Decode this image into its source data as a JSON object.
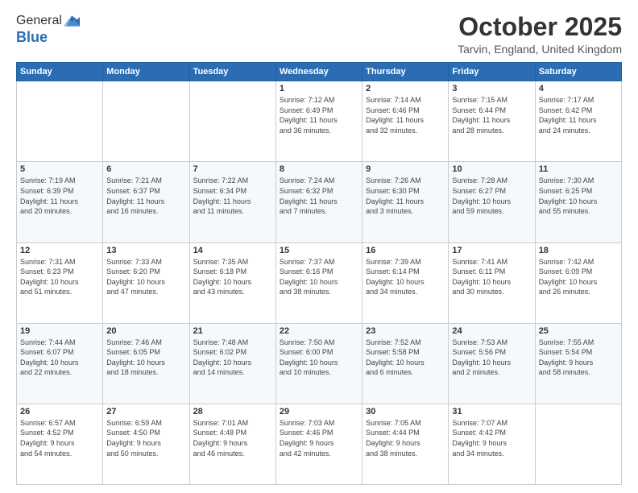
{
  "header": {
    "logo_line1": "General",
    "logo_line2": "Blue",
    "month": "October 2025",
    "location": "Tarvin, England, United Kingdom"
  },
  "weekdays": [
    "Sunday",
    "Monday",
    "Tuesday",
    "Wednesday",
    "Thursday",
    "Friday",
    "Saturday"
  ],
  "weeks": [
    [
      {
        "day": "",
        "info": ""
      },
      {
        "day": "",
        "info": ""
      },
      {
        "day": "",
        "info": ""
      },
      {
        "day": "1",
        "info": "Sunrise: 7:12 AM\nSunset: 6:49 PM\nDaylight: 11 hours\nand 36 minutes."
      },
      {
        "day": "2",
        "info": "Sunrise: 7:14 AM\nSunset: 6:46 PM\nDaylight: 11 hours\nand 32 minutes."
      },
      {
        "day": "3",
        "info": "Sunrise: 7:15 AM\nSunset: 6:44 PM\nDaylight: 11 hours\nand 28 minutes."
      },
      {
        "day": "4",
        "info": "Sunrise: 7:17 AM\nSunset: 6:42 PM\nDaylight: 11 hours\nand 24 minutes."
      }
    ],
    [
      {
        "day": "5",
        "info": "Sunrise: 7:19 AM\nSunset: 6:39 PM\nDaylight: 11 hours\nand 20 minutes."
      },
      {
        "day": "6",
        "info": "Sunrise: 7:21 AM\nSunset: 6:37 PM\nDaylight: 11 hours\nand 16 minutes."
      },
      {
        "day": "7",
        "info": "Sunrise: 7:22 AM\nSunset: 6:34 PM\nDaylight: 11 hours\nand 11 minutes."
      },
      {
        "day": "8",
        "info": "Sunrise: 7:24 AM\nSunset: 6:32 PM\nDaylight: 11 hours\nand 7 minutes."
      },
      {
        "day": "9",
        "info": "Sunrise: 7:26 AM\nSunset: 6:30 PM\nDaylight: 11 hours\nand 3 minutes."
      },
      {
        "day": "10",
        "info": "Sunrise: 7:28 AM\nSunset: 6:27 PM\nDaylight: 10 hours\nand 59 minutes."
      },
      {
        "day": "11",
        "info": "Sunrise: 7:30 AM\nSunset: 6:25 PM\nDaylight: 10 hours\nand 55 minutes."
      }
    ],
    [
      {
        "day": "12",
        "info": "Sunrise: 7:31 AM\nSunset: 6:23 PM\nDaylight: 10 hours\nand 51 minutes."
      },
      {
        "day": "13",
        "info": "Sunrise: 7:33 AM\nSunset: 6:20 PM\nDaylight: 10 hours\nand 47 minutes."
      },
      {
        "day": "14",
        "info": "Sunrise: 7:35 AM\nSunset: 6:18 PM\nDaylight: 10 hours\nand 43 minutes."
      },
      {
        "day": "15",
        "info": "Sunrise: 7:37 AM\nSunset: 6:16 PM\nDaylight: 10 hours\nand 38 minutes."
      },
      {
        "day": "16",
        "info": "Sunrise: 7:39 AM\nSunset: 6:14 PM\nDaylight: 10 hours\nand 34 minutes."
      },
      {
        "day": "17",
        "info": "Sunrise: 7:41 AM\nSunset: 6:11 PM\nDaylight: 10 hours\nand 30 minutes."
      },
      {
        "day": "18",
        "info": "Sunrise: 7:42 AM\nSunset: 6:09 PM\nDaylight: 10 hours\nand 26 minutes."
      }
    ],
    [
      {
        "day": "19",
        "info": "Sunrise: 7:44 AM\nSunset: 6:07 PM\nDaylight: 10 hours\nand 22 minutes."
      },
      {
        "day": "20",
        "info": "Sunrise: 7:46 AM\nSunset: 6:05 PM\nDaylight: 10 hours\nand 18 minutes."
      },
      {
        "day": "21",
        "info": "Sunrise: 7:48 AM\nSunset: 6:02 PM\nDaylight: 10 hours\nand 14 minutes."
      },
      {
        "day": "22",
        "info": "Sunrise: 7:50 AM\nSunset: 6:00 PM\nDaylight: 10 hours\nand 10 minutes."
      },
      {
        "day": "23",
        "info": "Sunrise: 7:52 AM\nSunset: 5:58 PM\nDaylight: 10 hours\nand 6 minutes."
      },
      {
        "day": "24",
        "info": "Sunrise: 7:53 AM\nSunset: 5:56 PM\nDaylight: 10 hours\nand 2 minutes."
      },
      {
        "day": "25",
        "info": "Sunrise: 7:55 AM\nSunset: 5:54 PM\nDaylight: 9 hours\nand 58 minutes."
      }
    ],
    [
      {
        "day": "26",
        "info": "Sunrise: 6:57 AM\nSunset: 4:52 PM\nDaylight: 9 hours\nand 54 minutes."
      },
      {
        "day": "27",
        "info": "Sunrise: 6:59 AM\nSunset: 4:50 PM\nDaylight: 9 hours\nand 50 minutes."
      },
      {
        "day": "28",
        "info": "Sunrise: 7:01 AM\nSunset: 4:48 PM\nDaylight: 9 hours\nand 46 minutes."
      },
      {
        "day": "29",
        "info": "Sunrise: 7:03 AM\nSunset: 4:46 PM\nDaylight: 9 hours\nand 42 minutes."
      },
      {
        "day": "30",
        "info": "Sunrise: 7:05 AM\nSunset: 4:44 PM\nDaylight: 9 hours\nand 38 minutes."
      },
      {
        "day": "31",
        "info": "Sunrise: 7:07 AM\nSunset: 4:42 PM\nDaylight: 9 hours\nand 34 minutes."
      },
      {
        "day": "",
        "info": ""
      }
    ]
  ]
}
